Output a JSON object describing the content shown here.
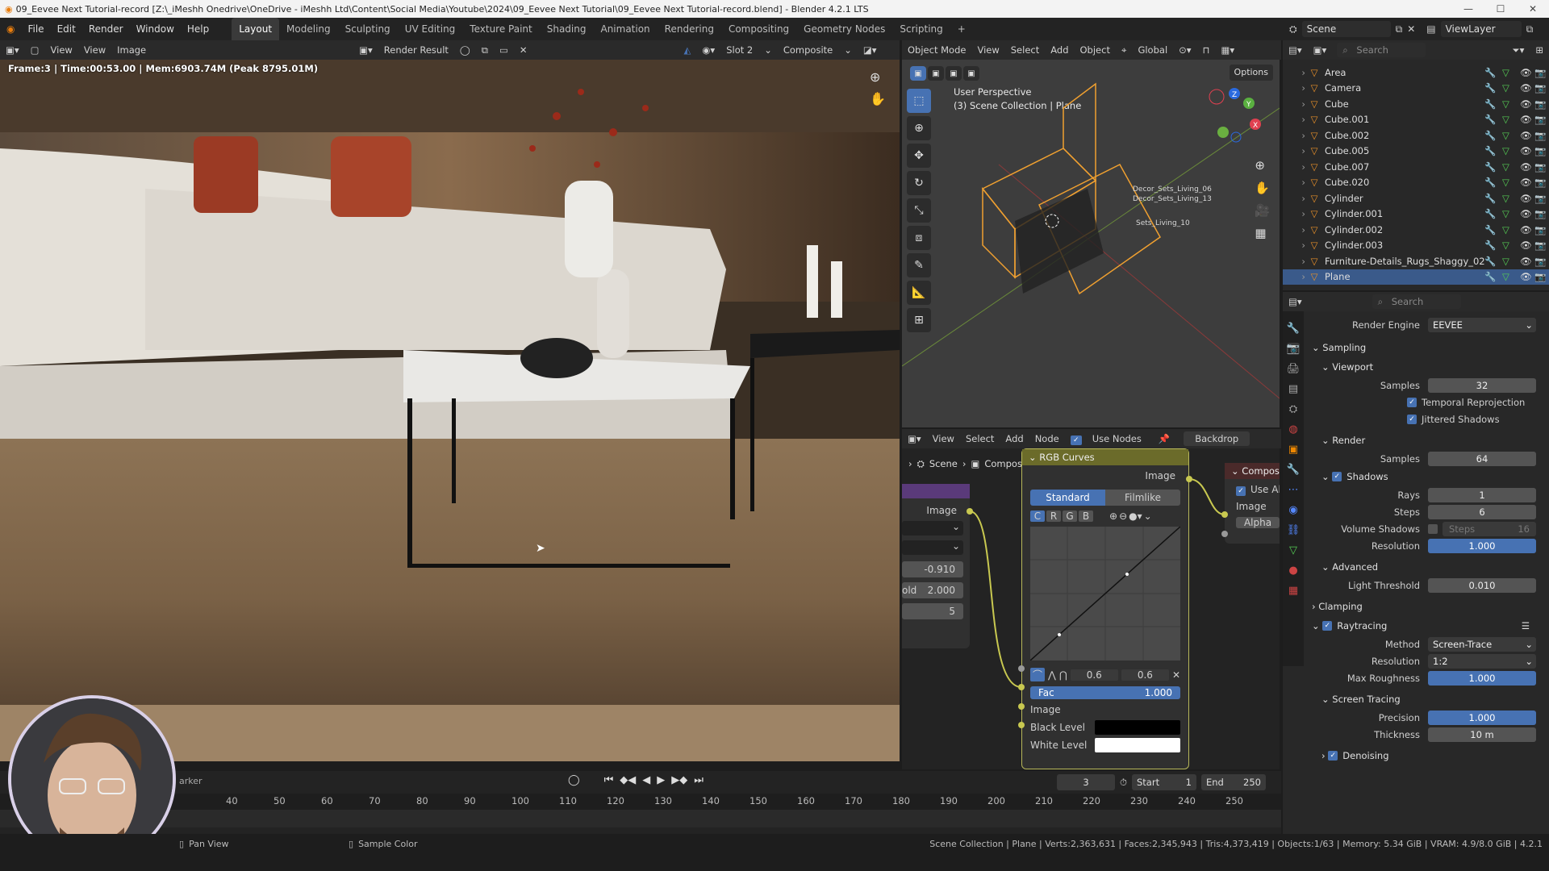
{
  "titlebar": {
    "title": "09_Eevee Next Tutorial-record [Z:\\_iMeshh Onedrive\\OneDrive - iMeshh Ltd\\Content\\Social Media\\Youtube\\2024\\09_Eevee Next Tutorial\\09_Eevee Next Tutorial-record.blend] - Blender 4.2.1 LTS"
  },
  "menu": [
    "File",
    "Edit",
    "Render",
    "Window",
    "Help"
  ],
  "workspaces": [
    "Layout",
    "Modeling",
    "Sculpting",
    "UV Editing",
    "Texture Paint",
    "Shading",
    "Animation",
    "Rendering",
    "Compositing",
    "Geometry Nodes",
    "Scripting"
  ],
  "scene": {
    "name": "Scene",
    "viewlayer": "ViewLayer"
  },
  "image_editor": {
    "view1": "View",
    "view2": "View",
    "image": "Image",
    "result": "Render Result",
    "slot": "Slot 2",
    "pass": "Composite",
    "frame_info": "Frame:3 | Time:00:53.00 | Mem:6903.74M (Peak 8795.01M)"
  },
  "viewport": {
    "mode": "Object Mode",
    "menus": [
      "View",
      "Select",
      "Add",
      "Object"
    ],
    "orientation": "Global",
    "options": "Options",
    "persp": "User Perspective",
    "collection": "(3) Scene Collection | Plane",
    "labels": [
      "Decor_Sets_Living_06",
      "Decor_Sets_Living_13",
      "Sets_Living_10"
    ]
  },
  "node_editor": {
    "menus": [
      "View",
      "Select",
      "Add",
      "Node"
    ],
    "use_nodes": "Use Nodes",
    "backdrop": "Backdrop",
    "breadcrumb": [
      "Scene",
      "Compositing Nodetree"
    ],
    "left_node": {
      "output": "Image",
      "v1": "-0.910",
      "v2_label": "old",
      "v2": "2.000",
      "v3": "5"
    },
    "curves": {
      "title": "RGB Curves",
      "out": "Image",
      "tab_standard": "Standard",
      "tab_filmlike": "Filmlike",
      "channels": [
        "C",
        "R",
        "G",
        "B"
      ],
      "x": "0.6",
      "y": "0.6",
      "fac_label": "Fac",
      "fac": "1.000",
      "in_image": "Image",
      "black": "Black Level",
      "white": "White Level"
    },
    "composite": {
      "title": "Compos",
      "use_alpha": "Use Alp",
      "image": "Image",
      "alpha": "Alpha"
    }
  },
  "outliner": {
    "search": "Search",
    "items": [
      {
        "name": "Area"
      },
      {
        "name": "Camera"
      },
      {
        "name": "Cube"
      },
      {
        "name": "Cube.001"
      },
      {
        "name": "Cube.002"
      },
      {
        "name": "Cube.005"
      },
      {
        "name": "Cube.007"
      },
      {
        "name": "Cube.020"
      },
      {
        "name": "Cylinder"
      },
      {
        "name": "Cylinder.001"
      },
      {
        "name": "Cylinder.002"
      },
      {
        "name": "Cylinder.003"
      },
      {
        "name": "Furniture-Details_Rugs_Shaggy_02"
      },
      {
        "name": "Plane"
      }
    ]
  },
  "properties": {
    "search": "Search",
    "engine_label": "Render Engine",
    "engine": "EEVEE",
    "sampling": "Sampling",
    "viewport": "Viewport",
    "samples_label": "Samples",
    "vp_samples": "32",
    "temporal": "Temporal Reprojection",
    "jittered": "Jittered Shadows",
    "render": "Render",
    "r_samples": "64",
    "shadows": "Shadows",
    "rays_label": "Rays",
    "rays": "1",
    "steps_label": "Steps",
    "steps": "6",
    "vol_shadows": "Volume Shadows",
    "vol_steps_label": "Steps",
    "vol_steps": "16",
    "resolution_label": "Resolution",
    "resolution": "1.000",
    "advanced": "Advanced",
    "light_threshold_label": "Light Threshold",
    "light_threshold": "0.010",
    "clamping": "Clamping",
    "raytracing": "Raytracing",
    "method_label": "Method",
    "method": "Screen-Trace",
    "rt_res_label": "Resolution",
    "rt_res": "1:2",
    "max_rough_label": "Max Roughness",
    "max_rough": "1.000",
    "screen_tracing": "Screen Tracing",
    "precision_label": "Precision",
    "precision": "1.000",
    "thickness_label": "Thickness",
    "thickness": "10 m",
    "denoising": "Denoising"
  },
  "timeline": {
    "marker": "arker",
    "current": "3",
    "start_label": "Start",
    "start": "1",
    "end_label": "End",
    "end": "250",
    "ticks": [
      "40",
      "50",
      "60",
      "70",
      "80",
      "90",
      "100",
      "110",
      "120",
      "130",
      "140",
      "150",
      "160",
      "170",
      "180",
      "190",
      "200",
      "210",
      "220",
      "230",
      "240",
      "250"
    ]
  },
  "status": {
    "pan": "Pan View",
    "sample": "Sample Color",
    "stats": "Scene Collection | Plane | Verts:2,363,631 | Faces:2,345,943 | Tris:4,373,419 | Objects:1/63 | Memory: 5.34 GiB | VRAM: 4.9/8.0 GiB | 4.2.1"
  }
}
